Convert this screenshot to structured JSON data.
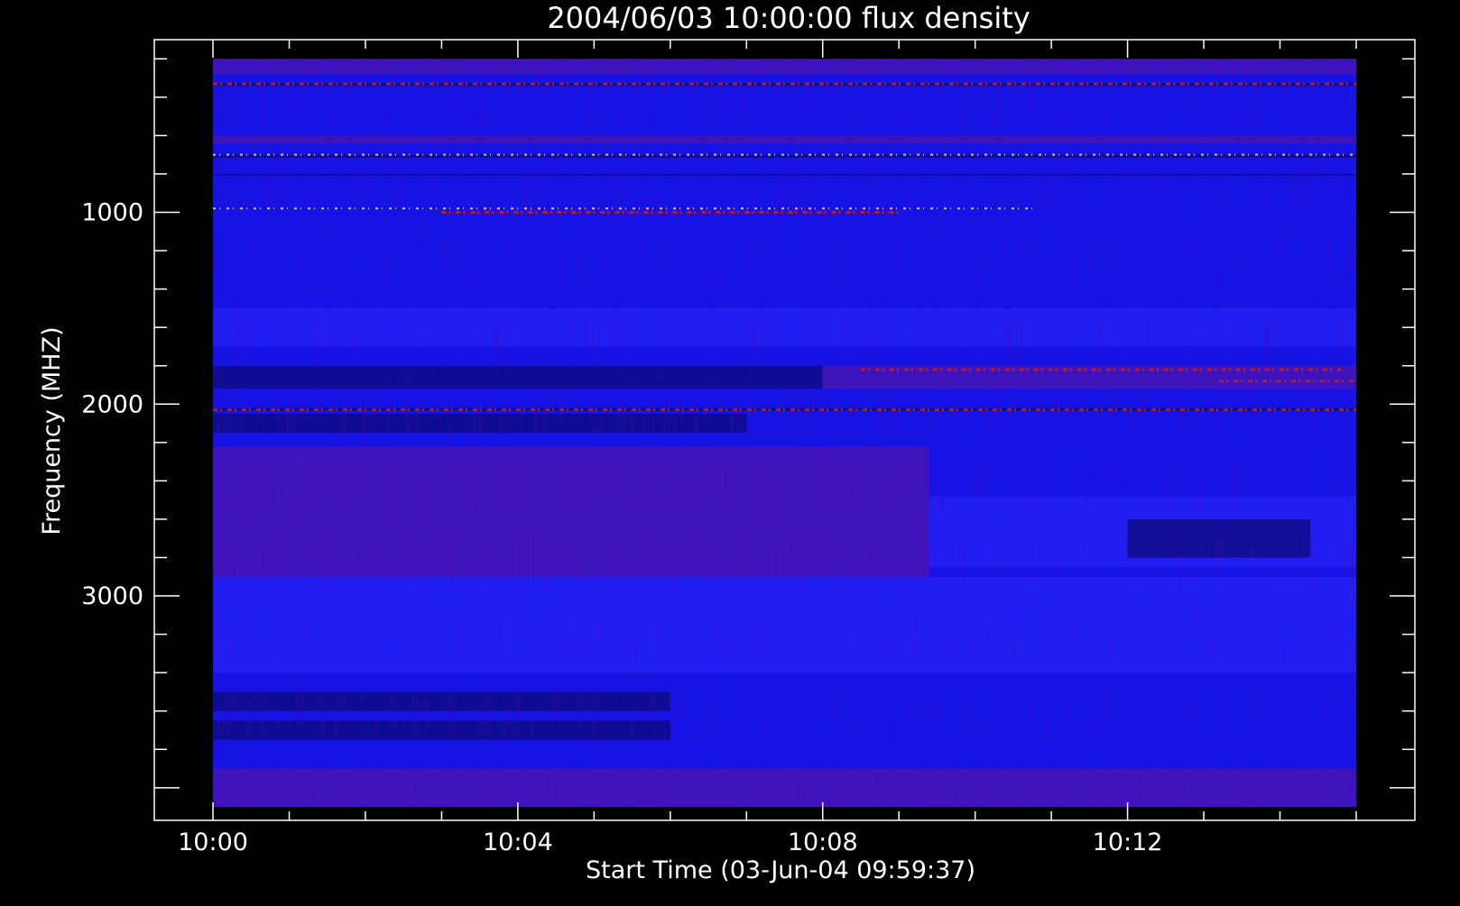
{
  "chart_data": {
    "type": "heatmap",
    "title": "2004/06/03 10:00:00 flux density",
    "xlabel": "Start Time (03-Jun-04 09:59:37)",
    "ylabel": "Frequency (MHZ)",
    "x_ticks": [
      {
        "label": "10:00",
        "minutes": 0
      },
      {
        "label": "10:04",
        "minutes": 4
      },
      {
        "label": "10:08",
        "minutes": 8
      },
      {
        "label": "10:12",
        "minutes": 12
      }
    ],
    "y_ticks": [
      {
        "label": "1000",
        "value": 1000
      },
      {
        "label": "2000",
        "value": 2000
      },
      {
        "label": "3000",
        "value": 3000
      }
    ],
    "x_range_minutes": [
      -0.77,
      15.77
    ],
    "y_range": [
      100,
      4170
    ],
    "data_x_range_minutes": [
      0,
      15
    ],
    "data_y_range": [
      200,
      4100
    ],
    "y_inverted": true,
    "colors": {
      "background": "#000000",
      "base": "#1414e6",
      "enhanced": "#5a14a0",
      "depleted": "#0a0a70",
      "bright": "#2828ff",
      "hot": "#c02020",
      "spot": "#ffd0a0"
    },
    "bands": [
      {
        "f0": 200,
        "f1": 280,
        "tone": "enhanced"
      },
      {
        "f0": 325,
        "f1": 340,
        "tone": "depleted"
      },
      {
        "f0": 600,
        "f1": 640,
        "tone": "enhanced"
      },
      {
        "f0": 700,
        "f1": 715,
        "tone": "depleted"
      },
      {
        "f0": 800,
        "f1": 808,
        "tone": "depleted"
      },
      {
        "f0": 1500,
        "f1": 1700,
        "tone": "bright"
      },
      {
        "f0": 1800,
        "f1": 1920,
        "tone": "depleted",
        "t0": 0,
        "t1": 8
      },
      {
        "f0": 1800,
        "f1": 1920,
        "tone": "enhanced",
        "t0": 8,
        "t1": 15
      },
      {
        "f0": 2020,
        "f1": 2035,
        "tone": "depleted"
      },
      {
        "f0": 2050,
        "f1": 2150,
        "tone": "depleted",
        "t0": 0,
        "t1": 7
      },
      {
        "f0": 2220,
        "f1": 2900,
        "tone": "enhanced",
        "t0": 0,
        "t1": 9.4
      },
      {
        "f0": 2480,
        "f1": 2850,
        "tone": "bright",
        "t0": 9.4,
        "t1": 15
      },
      {
        "f0": 2600,
        "f1": 2800,
        "tone": "depleted",
        "t0": 12,
        "t1": 14.4
      },
      {
        "f0": 2900,
        "f1": 3400,
        "tone": "bright"
      },
      {
        "f0": 3500,
        "f1": 3600,
        "tone": "depleted",
        "t0": 0,
        "t1": 6
      },
      {
        "f0": 3650,
        "f1": 3750,
        "tone": "depleted",
        "t0": 0,
        "t1": 6
      },
      {
        "f0": 3900,
        "f1": 4000,
        "tone": "enhanced"
      },
      {
        "f0": 4000,
        "f1": 4100,
        "tone": "enhanced"
      }
    ],
    "lines": [
      {
        "f": 330,
        "t0": 0,
        "t1": 15,
        "tone": "hot"
      },
      {
        "f": 700,
        "t0": 0,
        "t1": 15,
        "tone": "spot"
      },
      {
        "f": 980,
        "t0": 0,
        "t1": 10.8,
        "tone": "spot"
      },
      {
        "f": 1000,
        "t0": 3,
        "t1": 9,
        "tone": "hot"
      },
      {
        "f": 1820,
        "t0": 8.5,
        "t1": 14.8,
        "tone": "hot"
      },
      {
        "f": 1880,
        "t0": 13.2,
        "t1": 15,
        "tone": "hot"
      },
      {
        "f": 2030,
        "t0": 0,
        "t1": 15,
        "tone": "hot"
      }
    ]
  }
}
